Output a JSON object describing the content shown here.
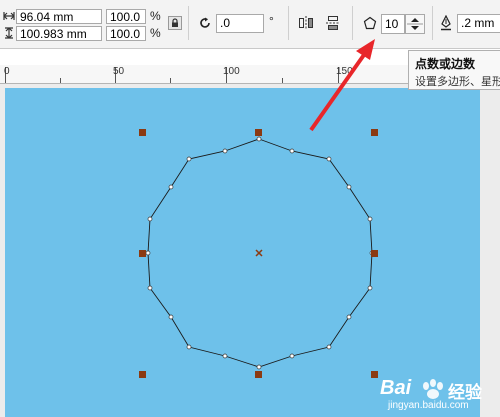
{
  "toolbar": {
    "width_value": "96.04 mm",
    "height_value": "100.983 mm",
    "scale_x": "100.0",
    "scale_y": "100.0",
    "percent_x": "%",
    "percent_y": "%",
    "rotation_value": ".0",
    "degree_symbol": "°",
    "sides_value": "10",
    "outline_width": ".2 mm"
  },
  "tooltip": {
    "title": "点数或边数",
    "description": "设置多边形、星形"
  },
  "ruler": {
    "labels": [
      "0",
      "50",
      "100",
      "150"
    ]
  },
  "watermark": {
    "brand": "Bai",
    "brand_cn": "经验",
    "url": "jingyan.baidu.com"
  },
  "colors": {
    "page_background": "#6ec1ea",
    "handle": "#8b3a12",
    "arrow": "#e8262a"
  },
  "icons": {
    "width": "width-arrows-icon",
    "height": "height-arrows-icon",
    "lock": "lock-icon",
    "rotate": "rotate-icon",
    "mirror_h": "mirror-horizontal-icon",
    "mirror_v": "mirror-vertical-icon",
    "polygon": "polygon-icon",
    "pen": "pen-icon"
  }
}
